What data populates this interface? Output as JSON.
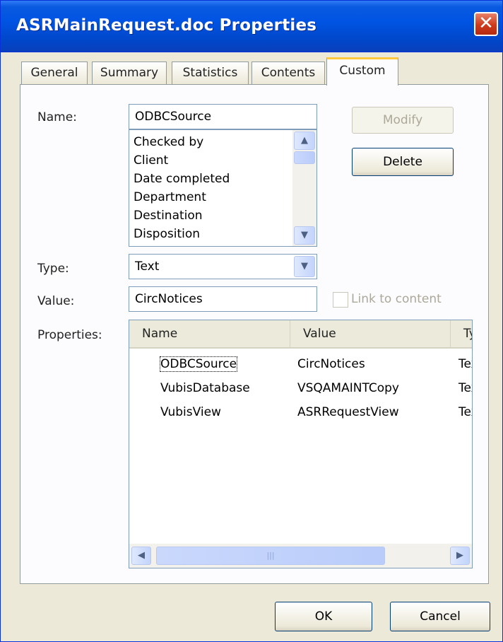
{
  "window": {
    "title": "ASRMainRequest.doc Properties",
    "close_glyph": "✕"
  },
  "tabs": [
    {
      "label": "General"
    },
    {
      "label": "Summary"
    },
    {
      "label": "Statistics"
    },
    {
      "label": "Contents"
    },
    {
      "label": "Custom",
      "active": true
    }
  ],
  "custom": {
    "name_label": "Name:",
    "name_value": "ODBCSource",
    "name_list": [
      "Checked by",
      "Client",
      "Date completed",
      "Department",
      "Destination",
      "Disposition"
    ],
    "type_label": "Type:",
    "type_value": "Text",
    "value_label": "Value:",
    "value_value": "CircNotices",
    "link_label": "Link to content",
    "link_checked": false,
    "modify_label": "Modify",
    "delete_label": "Delete",
    "properties_label": "Properties:",
    "columns": [
      "Name",
      "Value",
      "Type"
    ],
    "rows": [
      {
        "name": "ODBCSource",
        "value": "CircNotices",
        "type": "Text"
      },
      {
        "name": "VubisDatabase",
        "value": "VSQAMAINTCopy",
        "type": "Text"
      },
      {
        "name": "VubisView",
        "value": "ASRRequestView",
        "type": "Text"
      }
    ]
  },
  "footer": {
    "ok_label": "OK",
    "cancel_label": "Cancel"
  },
  "colors": {
    "titlebar": "#0054e3",
    "face": "#ece9d8",
    "field_border": "#7f9db9",
    "tab_highlight": "#ffc83c",
    "close_red": "#cf3a1b"
  },
  "icons": {
    "scroll_up": "▲",
    "scroll_down": "▼",
    "scroll_left": "◀",
    "scroll_right": "▶",
    "combo_arrow": "▼",
    "grip": "|||"
  }
}
